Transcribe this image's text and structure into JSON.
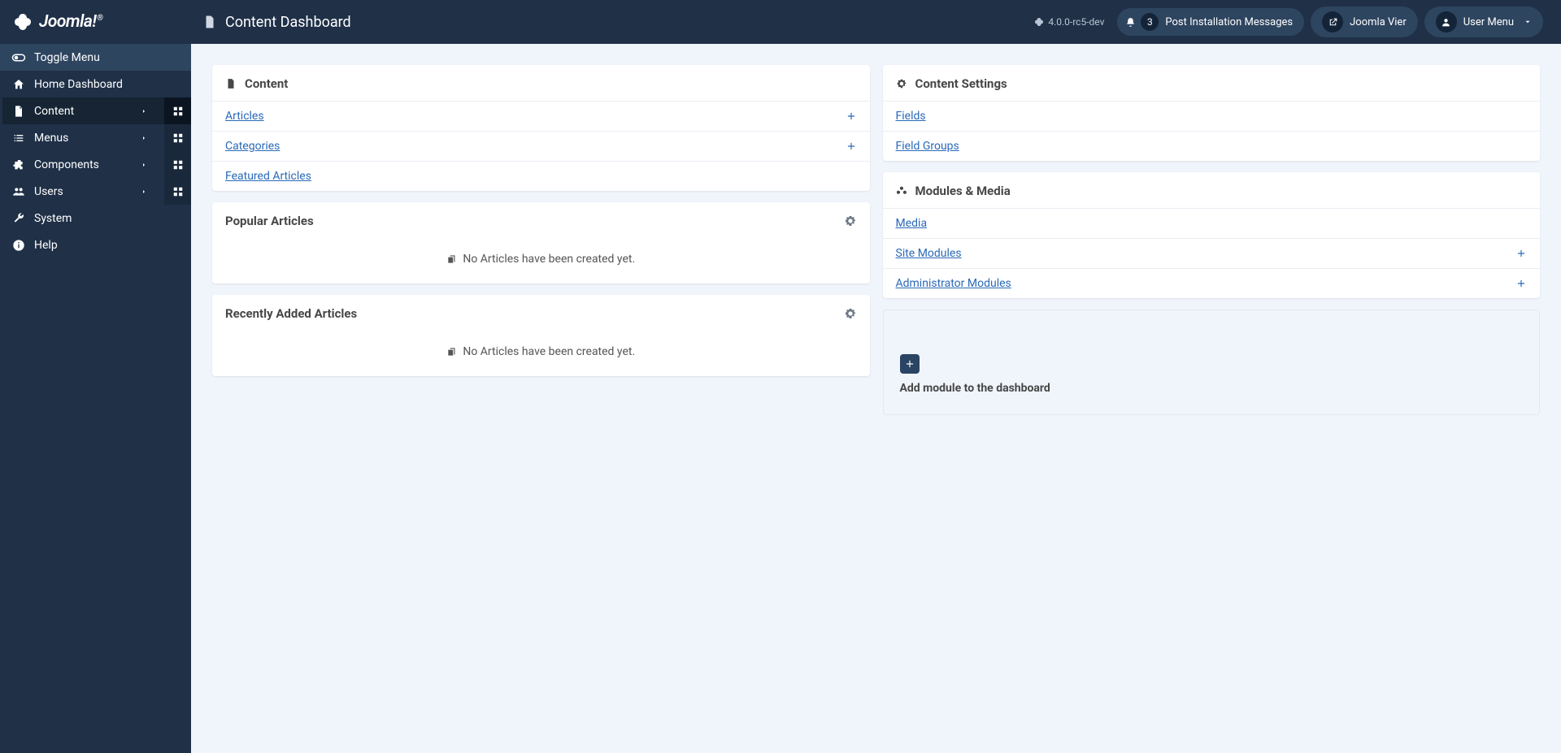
{
  "brand": {
    "name": "Joomla!"
  },
  "header": {
    "pageTitle": "Content Dashboard",
    "version": "4.0.0-rc5-dev",
    "notifCount": "3",
    "notifLabel": "Post Installation Messages",
    "siteLink": "Joomla Vier",
    "userMenu": "User Menu"
  },
  "sidebar": {
    "toggle": "Toggle Menu",
    "items": [
      {
        "label": "Home Dashboard",
        "icon": "home"
      },
      {
        "label": "Content",
        "icon": "file",
        "active": true,
        "chevron": true,
        "dash": true
      },
      {
        "label": "Menus",
        "icon": "list",
        "chevron": true,
        "dash": true
      },
      {
        "label": "Components",
        "icon": "puzzle",
        "chevron": true,
        "dash": true
      },
      {
        "label": "Users",
        "icon": "users",
        "chevron": true,
        "dash": true
      },
      {
        "label": "System",
        "icon": "wrench"
      },
      {
        "label": "Help",
        "icon": "info"
      }
    ]
  },
  "cards": {
    "content": {
      "title": "Content",
      "rows": [
        {
          "label": "Articles",
          "plus": true
        },
        {
          "label": "Categories",
          "plus": true
        },
        {
          "label": "Featured Articles"
        }
      ]
    },
    "popular": {
      "title": "Popular Articles",
      "empty": "No Articles have been created yet."
    },
    "recent": {
      "title": "Recently Added Articles",
      "empty": "No Articles have been created yet."
    },
    "settings": {
      "title": "Content Settings",
      "rows": [
        {
          "label": "Fields"
        },
        {
          "label": "Field Groups"
        }
      ]
    },
    "modules": {
      "title": "Modules & Media",
      "rows": [
        {
          "label": "Media"
        },
        {
          "label": "Site Modules",
          "plus": true
        },
        {
          "label": "Administrator Modules",
          "plus": true
        }
      ]
    },
    "addModule": {
      "label": "Add module to the dashboard"
    }
  }
}
